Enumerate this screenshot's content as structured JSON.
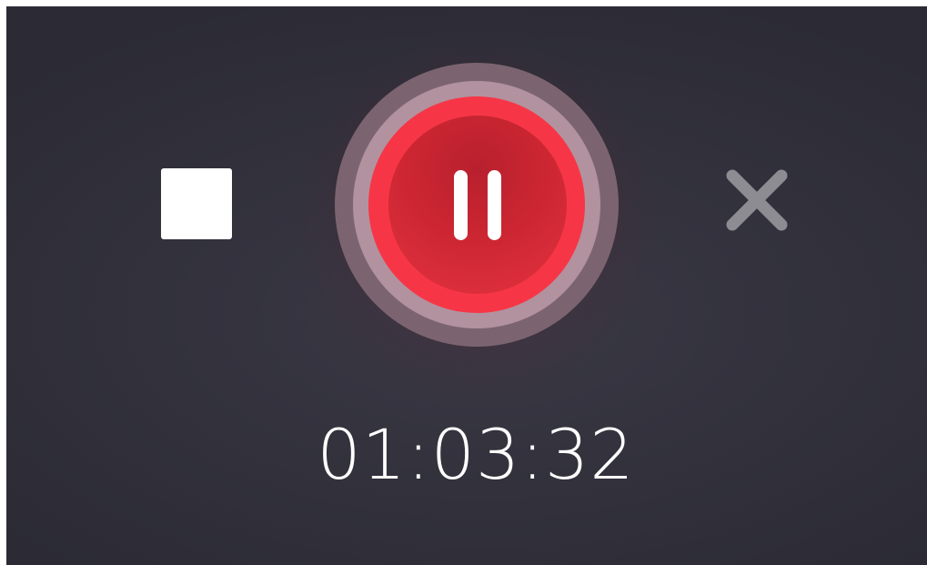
{
  "recorder": {
    "timer": "01:03:32",
    "controls": {
      "stop_icon": "stop-square-icon",
      "pause_icon": "pause-icon",
      "close_icon": "close-x-icon"
    },
    "colors": {
      "record_red": "#f63646",
      "record_core": "#cc2632",
      "ring_mid": "#b2929f",
      "ring_outer": "#7b6470",
      "close_gray": "#8d8c92",
      "background": "#33323d",
      "foreground": "#ffffff"
    }
  }
}
